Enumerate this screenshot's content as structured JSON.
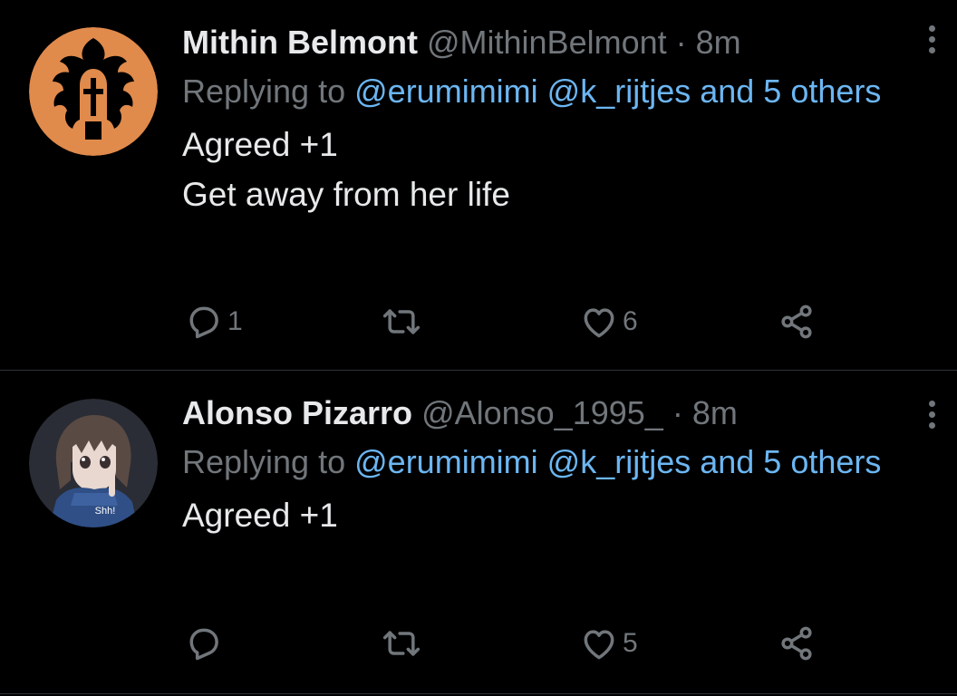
{
  "tweets": [
    {
      "name": "Mithin Belmont",
      "handle": "@MithinBelmont",
      "separator": "·",
      "time": "8m",
      "replying_prefix": "Replying to",
      "mentions": "@erumimimi @k_rijtjes and 5 others",
      "lines": [
        "Agreed +1",
        "Get away from her life"
      ],
      "reply_count": "1",
      "retweet_count": "",
      "like_count": "6",
      "avatar_bg": "#e08a4c"
    },
    {
      "name": "Alonso Pizarro",
      "handle": "@Alonso_1995_",
      "separator": "·",
      "time": "8m",
      "replying_prefix": "Replying to",
      "mentions": "@erumimimi @k_rijtjes and 5 others",
      "lines": [
        "Agreed +1"
      ],
      "reply_count": "",
      "retweet_count": "",
      "like_count": "5",
      "avatar_caption": "Shh!",
      "avatar_bg": "#2a2d35"
    }
  ],
  "icons": {
    "reply": "reply-icon",
    "retweet": "retweet-icon",
    "like": "heart-icon",
    "share": "share-icon",
    "more": "more-options-icon"
  },
  "colors": {
    "background": "#000000",
    "primary_text": "#e7e9ea",
    "secondary_text": "#71767b",
    "link": "#6cb6f2",
    "divider": "#2f3336"
  }
}
